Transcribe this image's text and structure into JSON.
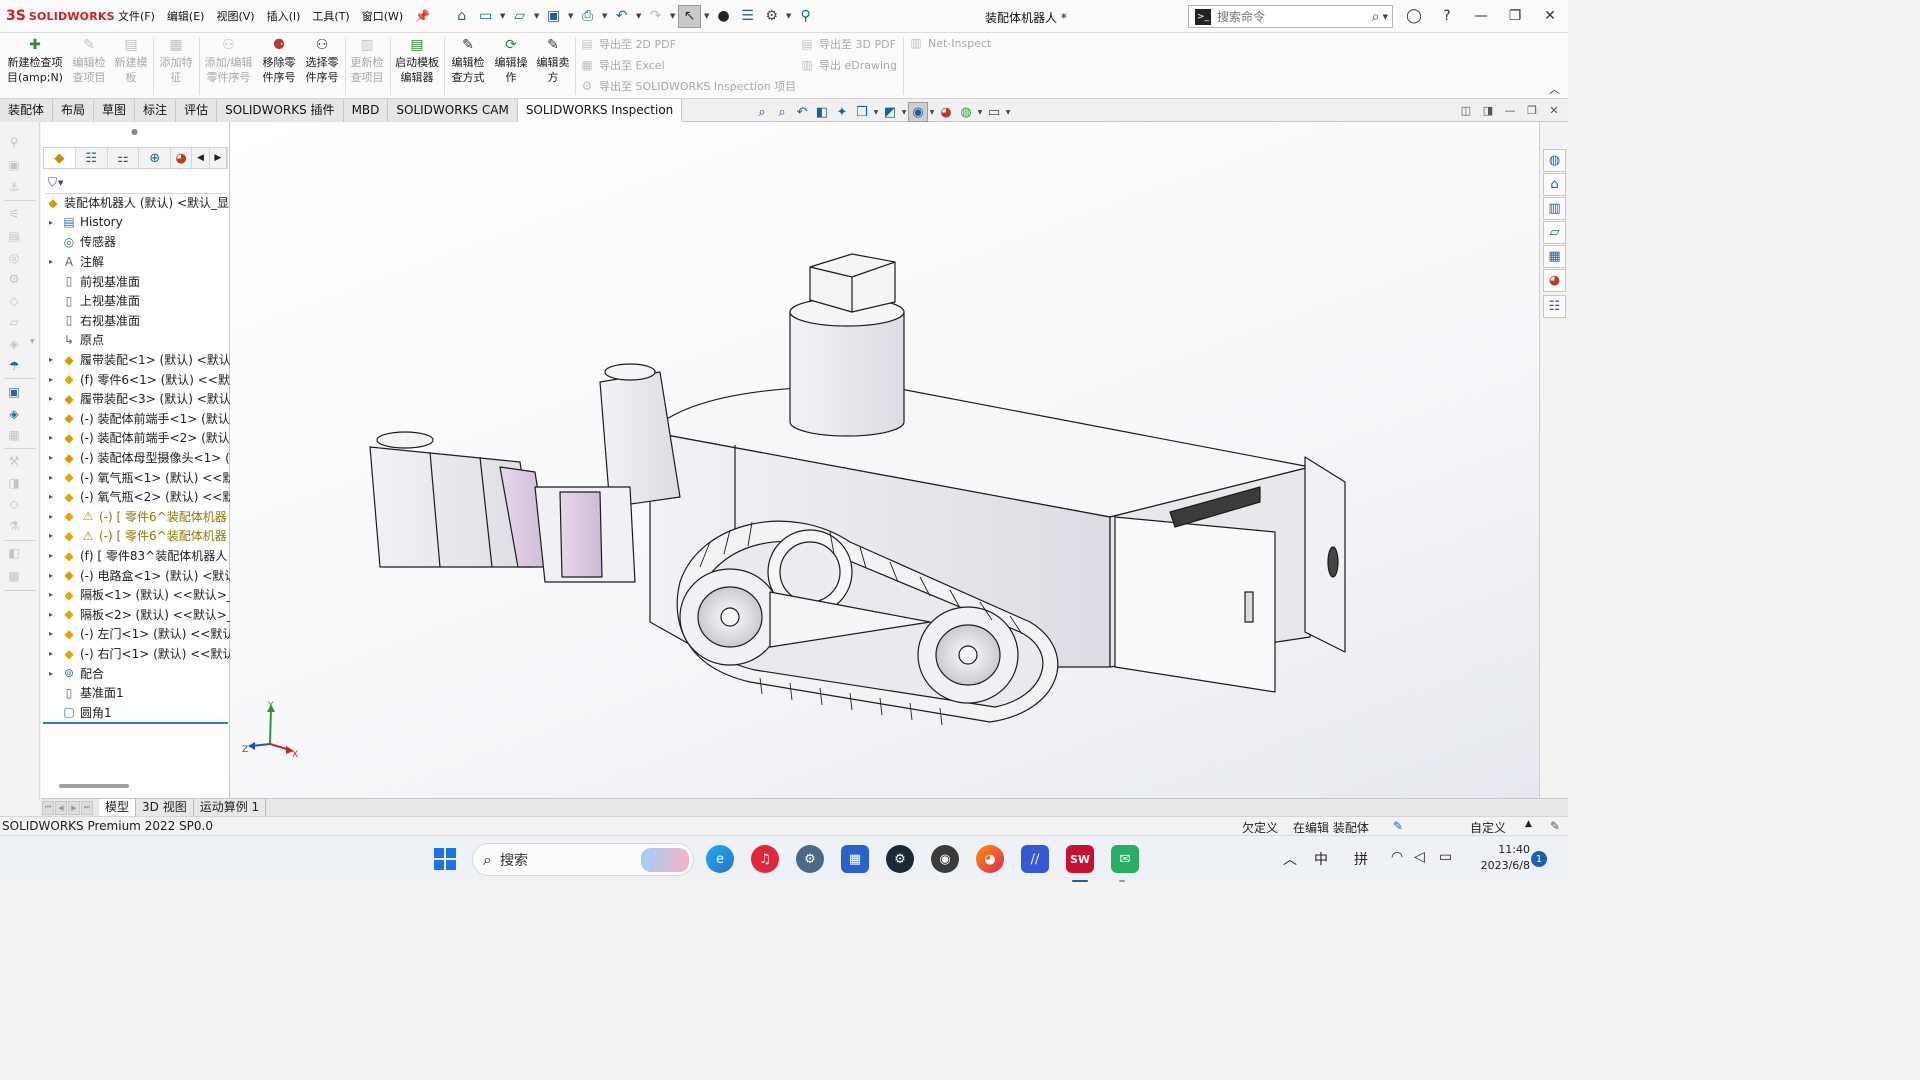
{
  "app": {
    "logo_mark": "3S",
    "logo_text": "SOLIDWORKS",
    "document_title": "装配体机器人 *"
  },
  "menu": [
    "文件(F)",
    "编辑(E)",
    "视图(V)",
    "插入(I)",
    "工具(T)",
    "窗口(W)"
  ],
  "search": {
    "placeholder": "搜索命令",
    "icon": "command-prompt-icon"
  },
  "ribbon": {
    "buttons": [
      {
        "label1": "新建检查项",
        "label2": "目(amp;N)",
        "enabled": true,
        "icon": "new-inspection-icon"
      },
      {
        "label1": "编辑检",
        "label2": "查项目",
        "enabled": false,
        "icon": "edit-inspection-icon"
      },
      {
        "label1": "新建模",
        "label2": "板",
        "enabled": false,
        "icon": "new-template-icon"
      },
      {
        "label1": "添加特",
        "label2": "征",
        "enabled": false,
        "icon": "add-feature-icon"
      },
      {
        "label1": "添加/编辑",
        "label2": "零件序号",
        "enabled": false,
        "icon": "add-balloon-icon"
      },
      {
        "label1": "移除零",
        "label2": "件序号",
        "enabled": true,
        "icon": "remove-balloon-icon"
      },
      {
        "label1": "选择零",
        "label2": "件序号",
        "enabled": true,
        "icon": "select-balloon-icon"
      },
      {
        "label1": "更新检",
        "label2": "查项目",
        "enabled": false,
        "icon": "update-inspection-icon"
      },
      {
        "label1": "启动模板",
        "label2": "编辑器",
        "enabled": true,
        "icon": "template-editor-icon"
      },
      {
        "label1": "编辑检",
        "label2": "查方式",
        "enabled": true,
        "icon": "edit-method-icon"
      },
      {
        "label1": "编辑操",
        "label2": "作",
        "enabled": true,
        "icon": "edit-operation-icon"
      },
      {
        "label1": "编辑卖",
        "label2": "方",
        "enabled": true,
        "icon": "edit-vendor-icon"
      }
    ],
    "exports_left": [
      "导出至 2D PDF",
      "导出至 Excel",
      "导出至 SOLIDWORKS Inspection 项目"
    ],
    "exports_right": [
      "导出至 3D PDF",
      "导出 eDrawing"
    ],
    "net_inspect": "Net-Inspect"
  },
  "tabs": [
    "装配体",
    "布局",
    "草图",
    "标注",
    "评估",
    "SOLIDWORKS 插件",
    "MBD",
    "SOLIDWORKS CAM",
    "SOLIDWORKS Inspection"
  ],
  "active_tab": "SOLIDWORKS Inspection",
  "tree": {
    "root": "装配体机器人 (默认) <默认_显",
    "items": [
      {
        "label": "History",
        "icon": "history-folder-icon",
        "expand": true
      },
      {
        "label": "传感器",
        "icon": "sensor-folder-icon",
        "expand": false
      },
      {
        "label": "注解",
        "icon": "annotations-folder-icon",
        "expand": true
      },
      {
        "label": "前视基准面",
        "icon": "plane-icon",
        "expand": false
      },
      {
        "label": "上视基准面",
        "icon": "plane-icon",
        "expand": false
      },
      {
        "label": "右视基准面",
        "icon": "plane-icon",
        "expand": false
      },
      {
        "label": "原点",
        "icon": "origin-icon",
        "expand": false
      },
      {
        "label": "履带装配<1> (默认) <默认",
        "icon": "subassembly-icon",
        "expand": true
      },
      {
        "label": "(f) 零件6<1> (默认) <<默认",
        "icon": "part-icon",
        "expand": true
      },
      {
        "label": "履带装配<3> (默认) <默认",
        "icon": "subassembly-icon",
        "expand": true
      },
      {
        "label": "(-) 装配体前端手<1> (默认",
        "icon": "subassembly-icon",
        "expand": true
      },
      {
        "label": "(-) 装配体前端手<2> (默认",
        "icon": "subassembly-icon",
        "expand": true
      },
      {
        "label": "(-) 装配体母型摄像头<1> (",
        "icon": "subassembly-icon",
        "expand": true
      },
      {
        "label": "(-) 氧气瓶<1> (默认) <<默",
        "icon": "part-icon",
        "expand": true
      },
      {
        "label": "(-) 氧气瓶<2> (默认) <<默",
        "icon": "part-icon",
        "expand": true
      },
      {
        "label": "(-) [ 零件6^装配体机器",
        "icon": "part-warning-icon",
        "expand": true,
        "warn": true
      },
      {
        "label": "(-) [ 零件6^装配体机器",
        "icon": "part-warning-icon",
        "expand": true,
        "warn": true
      },
      {
        "label": "(f) [ 零件83^装配体机器人",
        "icon": "part-icon",
        "expand": true
      },
      {
        "label": "(-) 电路盒<1> (默认) <默认",
        "icon": "subassembly-icon",
        "expand": true
      },
      {
        "label": "隔板<1> (默认) <<默认>_",
        "icon": "part-icon",
        "expand": true
      },
      {
        "label": "隔板<2> (默认) <<默认>_",
        "icon": "part-icon",
        "expand": true
      },
      {
        "label": "(-) 左门<1> (默认) <<默认",
        "icon": "part-icon",
        "expand": true
      },
      {
        "label": "(-) 右门<1> (默认) <<默认",
        "icon": "part-icon",
        "expand": true
      },
      {
        "label": "配合",
        "icon": "mates-icon",
        "expand": true
      },
      {
        "label": "基准面1",
        "icon": "plane-feature-icon",
        "expand": false
      },
      {
        "label": "圆角1",
        "icon": "fillet-icon",
        "expand": false
      }
    ]
  },
  "triad": {
    "x": "X",
    "y": "Y",
    "z": "Z"
  },
  "model_tabs": [
    "模型",
    "3D 视图",
    "运动算例 1"
  ],
  "active_model_tab": "模型",
  "status": {
    "product": "SOLIDWORKS Premium 2022 SP0.0",
    "definition": "欠定义",
    "editing": "在编辑 装配体",
    "units": "自定义"
  },
  "taskbar": {
    "search_placeholder": "搜索",
    "ime_1": "中",
    "ime_2": "拼",
    "time": "11:40",
    "date": "2023/6/8",
    "notifications": "1",
    "sw_badge": "SW"
  }
}
